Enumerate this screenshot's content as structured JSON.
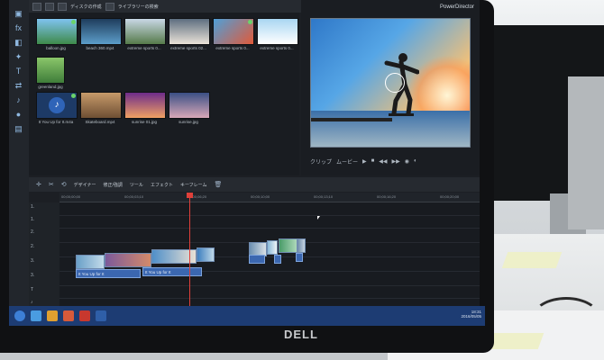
{
  "library": {
    "toolbar_items": [
      "ディスクの作成",
      "ライブラリーの検索"
    ],
    "media": [
      {
        "label": "balloon.jpg",
        "icon": "image",
        "check": true
      },
      {
        "label": "beach 360.mp4",
        "icon": "video",
        "check": false
      },
      {
        "label": "extreme sports 0...",
        "icon": "video",
        "check": false
      },
      {
        "label": "extreme sports 02...",
        "icon": "video",
        "check": false
      },
      {
        "label": "extreme sports 0...",
        "icon": "video",
        "check": false
      },
      {
        "label": "extreme sports 0...",
        "icon": "video",
        "check": false
      },
      {
        "label": "greenland.jpg",
        "icon": "image",
        "check": false
      },
      {
        "label": "It You Up for It.m4a",
        "icon": "music-note-icon",
        "check": true
      },
      {
        "label": "Skateboard.mp4",
        "icon": "video",
        "check": false
      },
      {
        "label": "sunrise 01.jpg",
        "icon": "image",
        "check": false
      },
      {
        "label": "sunrise.jpg",
        "icon": "image",
        "check": false
      }
    ]
  },
  "preview": {
    "brand": "PowerDirector",
    "controls": [
      "クリップ",
      "ムービー"
    ]
  },
  "timeline": {
    "toolbar": [
      "デザイナー",
      "修正/強調",
      "ツール",
      "エフェクト",
      "キーフレーム"
    ],
    "ruler_ticks": [
      "00;00;00;00",
      "00;00;03;10",
      "00;00;06;20",
      "00;00;10;00",
      "00;00;13;10",
      "00;00;16;20",
      "00;00;20;00"
    ],
    "tracks": [
      "1.",
      "1.",
      "2.",
      "2.",
      "3.",
      "3.",
      "T",
      "♪"
    ],
    "audio_clips": [
      "It You Up for It",
      "It You Up for It"
    ]
  },
  "monitor": {
    "brand": "DELL"
  },
  "taskbar": {
    "time": "18:31",
    "date": "2016/05/05"
  },
  "colors": {
    "accent": "#3b67b0",
    "playhead": "#e0403a",
    "taskbar": "#1d3c73"
  }
}
